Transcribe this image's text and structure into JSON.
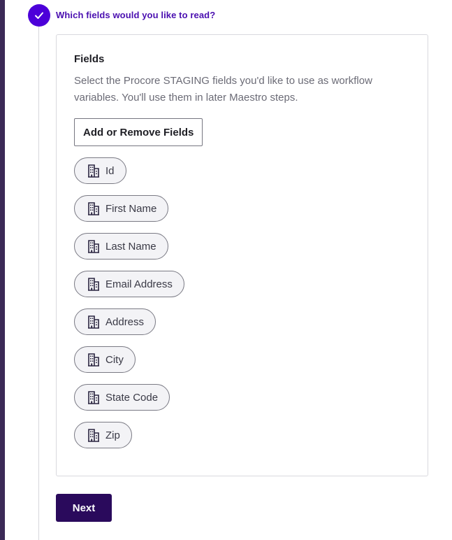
{
  "step": {
    "title": "Which fields would you like to read?",
    "status": "completed",
    "accent_color": "#4c00d9"
  },
  "fields_card": {
    "heading": "Fields",
    "description": "Select the Procore STAGING fields you'd like to use as workflow variables. You'll use them in later Maestro steps.",
    "add_remove_label": "Add or Remove Fields",
    "chip_icon": "building-icon",
    "fields": [
      {
        "label": "Id"
      },
      {
        "label": "First Name"
      },
      {
        "label": "Last Name"
      },
      {
        "label": "Email Address"
      },
      {
        "label": "Address"
      },
      {
        "label": "City"
      },
      {
        "label": "State Code"
      },
      {
        "label": "Zip"
      }
    ]
  },
  "footer": {
    "next_label": "Next",
    "button_color": "#2a0a5c"
  }
}
